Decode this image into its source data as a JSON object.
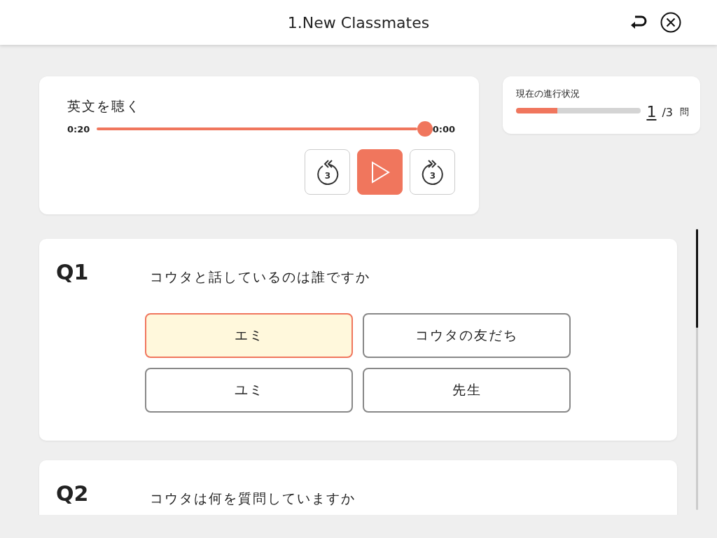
{
  "header": {
    "title": "1.New Classmates"
  },
  "player": {
    "title": "英文を聴く",
    "elapsed": "0:20",
    "remaining": "0:00",
    "level": 1,
    "playing": false,
    "rewind_label": "3",
    "forward_label": "3"
  },
  "progress": {
    "label": "現在の進行状況",
    "level": 0.33,
    "current": "1",
    "total": "/3",
    "unit": "問"
  },
  "questions": [
    {
      "number": "Q1",
      "text": "コウタと話しているのは誰ですか",
      "options": [
        {
          "label": "エミ",
          "selected": true
        },
        {
          "label": "コウタの友だち",
          "selected": false
        },
        {
          "label": "ユミ",
          "selected": false
        },
        {
          "label": "先生",
          "selected": false
        }
      ]
    },
    {
      "number": "Q2",
      "text": "コウタは何を質問していますか"
    }
  ]
}
